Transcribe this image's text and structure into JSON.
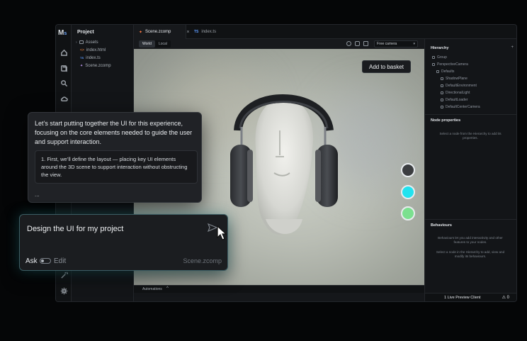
{
  "app": {
    "logo": "M",
    "logo_sub": "s"
  },
  "rail_icons": [
    "home-icon",
    "files-icon",
    "search-icon",
    "cloud-icon",
    "wand-icon",
    "gear-icon"
  ],
  "project": {
    "title": "Project",
    "tree": [
      {
        "label": "Assets",
        "icon": "folder-icon"
      },
      {
        "label": "index.html",
        "icon": "html-file-icon"
      },
      {
        "label": "index.ts",
        "icon": "ts-file-icon"
      },
      {
        "label": "Scene.zcomp",
        "icon": "scene-file-icon"
      }
    ]
  },
  "tabs": [
    {
      "label": "Scene.zcomp",
      "active": true,
      "close": "×"
    },
    {
      "badge": "TS",
      "label": "index.ts",
      "active": false
    }
  ],
  "viewport_toolbar": {
    "space_options": [
      "World",
      "Local"
    ],
    "space_selected": "World",
    "camera_select": "Free camera"
  },
  "viewport": {
    "cta": "Add to basket",
    "swatches": [
      {
        "name": "charcoal",
        "color": "#3b3d40"
      },
      {
        "name": "cyan",
        "color": "#22e3ef"
      },
      {
        "name": "green",
        "color": "#7be08f"
      }
    ]
  },
  "automations": {
    "label": "Automations",
    "chevron": "^"
  },
  "hierarchy": {
    "title": "Hierarchy",
    "add": "+",
    "items": [
      {
        "label": "Group",
        "indent": 0
      },
      {
        "label": "PerspectiveCamera",
        "indent": 0
      },
      {
        "label": "Defaults",
        "indent": 1
      },
      {
        "label": "ShadowPlane",
        "indent": 2
      },
      {
        "label": "DefaultEnvironment",
        "indent": 2
      },
      {
        "label": "DirectionalLight",
        "indent": 2
      },
      {
        "label": "DefaultLoader",
        "indent": 2
      },
      {
        "label": "DefaultCenterCamera",
        "indent": 2
      }
    ]
  },
  "node_properties": {
    "title": "Node properties",
    "empty": "Select a node from the Hierarchy to add its properties."
  },
  "behaviours": {
    "title": "Behaviours",
    "empty1": "Behaviours let you add interactivity and other features to your nodes.",
    "empty2": "Select a node in the Hierarchy to add, view and modify its behaviours."
  },
  "status": {
    "live": "1 Live Preview Client",
    "warnings": "0"
  },
  "chat": {
    "intro": "Let’s start putting together the UI for this experience, focusing on the core elements needed to guide the user and support interaction.",
    "step": "1. First, we’ll define the layout — placing key UI elements around the 3D scene to support interaction without obstructing the view.",
    "more": "..."
  },
  "composer": {
    "prompt": "Design the UI for my project",
    "mode_ask": "Ask",
    "mode_edit": "Edit",
    "context_file": "Scene.zcomp"
  }
}
